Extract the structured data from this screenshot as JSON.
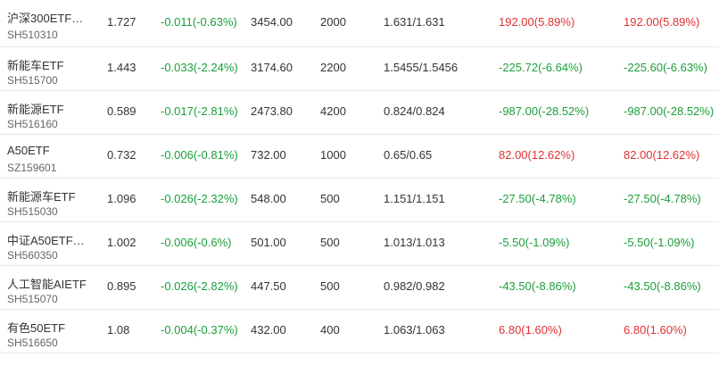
{
  "colors": {
    "gain": "#e03131",
    "loss": "#1a9e3a"
  },
  "rows": [
    {
      "name": "沪深300ETF…",
      "code": "SH510310",
      "price": "1.727",
      "change": "-0.011(-0.63%)",
      "value": "3454.00",
      "qty": "2000",
      "cost": "1.631/1.631",
      "pnl1": "192.00(5.89%)",
      "pnl2": "192.00(5.89%)"
    },
    {
      "name": "新能车ETF",
      "code": "SH515700",
      "price": "1.443",
      "change": "-0.033(-2.24%)",
      "value": "3174.60",
      "qty": "2200",
      "cost": "1.5455/1.5456",
      "pnl1": "-225.72(-6.64%)",
      "pnl2": "-225.60(-6.63%)"
    },
    {
      "name": "新能源ETF",
      "code": "SH516160",
      "price": "0.589",
      "change": "-0.017(-2.81%)",
      "value": "2473.80",
      "qty": "4200",
      "cost": "0.824/0.824",
      "pnl1": "-987.00(-28.52%)",
      "pnl2": "-987.00(-28.52%)"
    },
    {
      "name": "A50ETF",
      "code": "SZ159601",
      "price": "0.732",
      "change": "-0.006(-0.81%)",
      "value": "732.00",
      "qty": "1000",
      "cost": "0.65/0.65",
      "pnl1": "82.00(12.62%)",
      "pnl2": "82.00(12.62%)"
    },
    {
      "name": "新能源车ETF",
      "code": "SH515030",
      "price": "1.096",
      "change": "-0.026(-2.32%)",
      "value": "548.00",
      "qty": "500",
      "cost": "1.151/1.151",
      "pnl1": "-27.50(-4.78%)",
      "pnl2": "-27.50(-4.78%)"
    },
    {
      "name": "中证A50ETF…",
      "code": "SH560350",
      "price": "1.002",
      "change": "-0.006(-0.6%)",
      "value": "501.00",
      "qty": "500",
      "cost": "1.013/1.013",
      "pnl1": "-5.50(-1.09%)",
      "pnl2": "-5.50(-1.09%)"
    },
    {
      "name": "人工智能AIETF",
      "code": "SH515070",
      "price": "0.895",
      "change": "-0.026(-2.82%)",
      "value": "447.50",
      "qty": "500",
      "cost": "0.982/0.982",
      "pnl1": "-43.50(-8.86%)",
      "pnl2": "-43.50(-8.86%)"
    },
    {
      "name": "有色50ETF",
      "code": "SH516650",
      "price": "1.08",
      "change": "-0.004(-0.37%)",
      "value": "432.00",
      "qty": "400",
      "cost": "1.063/1.063",
      "pnl1": "6.80(1.60%)",
      "pnl2": "6.80(1.60%)"
    }
  ]
}
